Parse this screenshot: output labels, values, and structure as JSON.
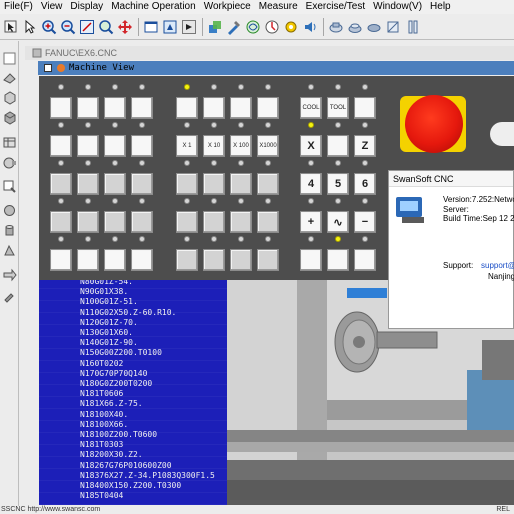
{
  "menu": [
    "File(F)",
    "View",
    "Display",
    "Machine Operation",
    "Workpiece",
    "Measure",
    "Exercise/Test",
    "Window(V)",
    "Help"
  ],
  "subwindow": {
    "title": "FANUC\\EX6.CNC"
  },
  "machine_view": {
    "title": "Machine View"
  },
  "panel": {
    "row2_labels": [
      "X 1",
      "X 10",
      "X 100",
      "X1000"
    ],
    "right_keys": [
      "COOL",
      "TOOL"
    ],
    "axis_keys": [
      "X",
      "Z",
      "4",
      "5",
      "6",
      "+",
      "∿",
      "−"
    ]
  },
  "program_lines": [
    "N80G01Z-54.",
    "N90G01X38.",
    "N100G01Z-51.",
    "N110G02X50.Z-60.R10.",
    "N120G01Z-70.",
    "N130G01X60.",
    "N140G01Z-90.",
    "N150G00Z200.T0100",
    "N160T0202",
    "N170G70P70Q140",
    "N180G0Z200T0200",
    "N181T0606",
    "N181X66.Z-75.",
    "N18100X40.",
    "N18100X66.",
    "N18100Z200.T0600",
    "N181T0303",
    "N18200X30.Z2.",
    "N18267G76P010600Z00",
    "N18376X27.Z-34.P1083Q300F1.5",
    "N18400X150.Z200.T0300",
    "N185T0404"
  ],
  "about_dialog": {
    "title": "SwanSoft CNC",
    "version": "Version:7.252:Networ",
    "server": "Server:",
    "build": "Build Time:Sep 12 20",
    "support_label": "Support:",
    "support_value": "support@",
    "city": "Nanjing"
  },
  "status": {
    "left": "SSCNC http://www.swansc.com",
    "right": "REL"
  }
}
